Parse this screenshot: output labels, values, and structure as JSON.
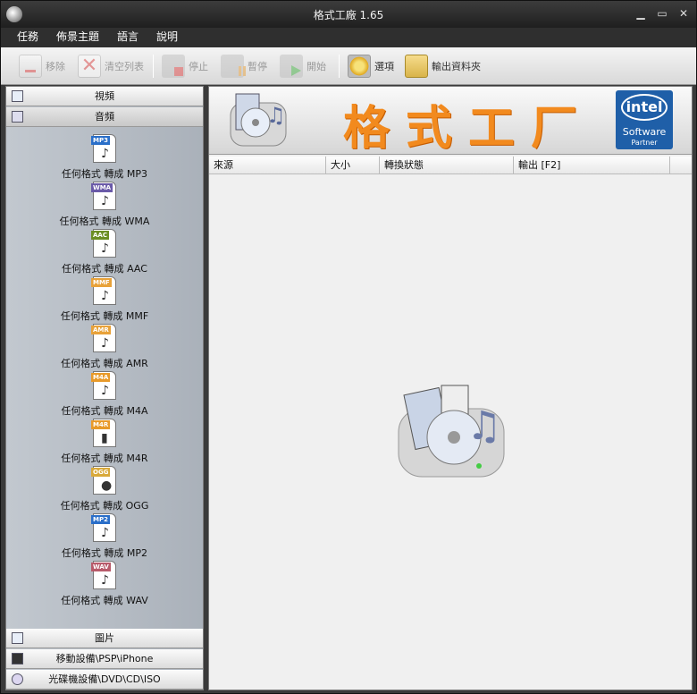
{
  "window": {
    "title": "格式工廠 1.65",
    "minimize": "▁",
    "maximize": "▭",
    "close": "✕"
  },
  "menu": [
    "任務",
    "佈景主題",
    "語言",
    "說明"
  ],
  "toolbar": {
    "remove": "移除",
    "clear": "清空列表",
    "stop": "停止",
    "pause": "暫停",
    "start": "開始",
    "options": "選項",
    "output_folder": "輸出資料夾"
  },
  "sidebar": {
    "video": "視頻",
    "audio": "音頻",
    "picture": "圖片",
    "mobile": "移動設備\\PSP\\iPhone",
    "disc": "光碟機設備\\DVD\\CD\\ISO",
    "formats": [
      {
        "tag": "MP3",
        "label": "任何格式 轉成 MP3",
        "color": "#2a6fc9"
      },
      {
        "tag": "WMA",
        "label": "任何格式 轉成 WMA",
        "color": "#6a5aa8"
      },
      {
        "tag": "AAC",
        "label": "任何格式 轉成 AAC",
        "color": "#6b8e23"
      },
      {
        "tag": "MMF",
        "label": "任何格式 轉成 MMF",
        "color": "#e8a23a"
      },
      {
        "tag": "AMR",
        "label": "任何格式 轉成 AMR",
        "color": "#e8a23a"
      },
      {
        "tag": "M4A",
        "label": "任何格式 轉成 M4A",
        "color": "#e89a2a"
      },
      {
        "tag": "M4R",
        "label": "任何格式 轉成 M4R",
        "color": "#e89a2a"
      },
      {
        "tag": "OGG",
        "label": "任何格式 轉成 OGG",
        "color": "#d9a93a"
      },
      {
        "tag": "MP2",
        "label": "任何格式 轉成 MP2",
        "color": "#2a6fc9"
      },
      {
        "tag": "WAV",
        "label": "任何格式 轉成 WAV",
        "color": "#b85a6a"
      }
    ]
  },
  "banner": {
    "brand": "格式工厂",
    "intel": "intel",
    "intel_sub": "Software",
    "intel_partner": "Partner"
  },
  "table": {
    "headers": [
      "來源",
      "大小",
      "轉換狀態",
      "輸出 [F2]"
    ]
  }
}
